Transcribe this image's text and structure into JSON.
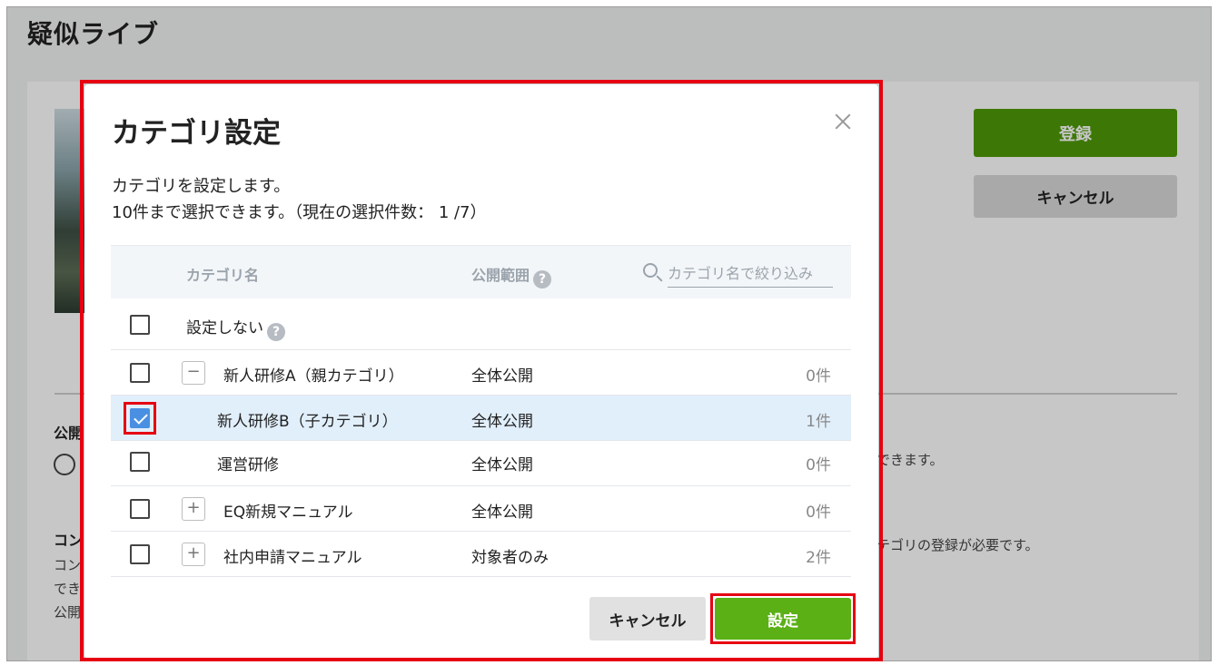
{
  "background": {
    "page_title": "疑似ライブ",
    "register_label": "登録",
    "cancel_label": "キャンセル",
    "frag_publish_label": "公開",
    "frag_content_label": "コン",
    "frag_content_line1": "コン",
    "frag_content_line2": "でき",
    "frag_content_line3": "公開",
    "frag_right_text1": "できます。",
    "frag_right_text2": "テゴリの登録が必要です。"
  },
  "modal": {
    "title": "カテゴリ設定",
    "desc_line1": "カテゴリを設定します。",
    "desc_line2": "10件まで選択できます。（現在の選択件数： 1 /7）",
    "table": {
      "col_name": "カテゴリ名",
      "col_scope": "公開範囲",
      "help_glyph": "?",
      "search_placeholder": "カテゴリ名で絞り込み",
      "none_label": "設定しない",
      "rows": [
        {
          "name": "新人研修A（親カテゴリ）",
          "scope": "全体公開",
          "count": "0件",
          "toggle": "−",
          "checked": false
        },
        {
          "name": "新人研修B（子カテゴリ）",
          "scope": "全体公開",
          "count": "1件",
          "toggle": "",
          "checked": true
        },
        {
          "name": "運営研修",
          "scope": "全体公開",
          "count": "0件",
          "toggle": "",
          "checked": false
        },
        {
          "name": "EQ新規マニュアル",
          "scope": "全体公開",
          "count": "0件",
          "toggle": "+",
          "checked": false
        },
        {
          "name": "社内申請マニュアル",
          "scope": "対象者のみ",
          "count": "2件",
          "toggle": "+",
          "checked": false
        }
      ]
    },
    "cancel_label": "キャンセル",
    "set_label": "設定"
  },
  "colors": {
    "accent_green": "#5ab015",
    "register_green": "#4f9a08",
    "highlight_red": "#e60012",
    "check_blue": "#4a90e2"
  }
}
